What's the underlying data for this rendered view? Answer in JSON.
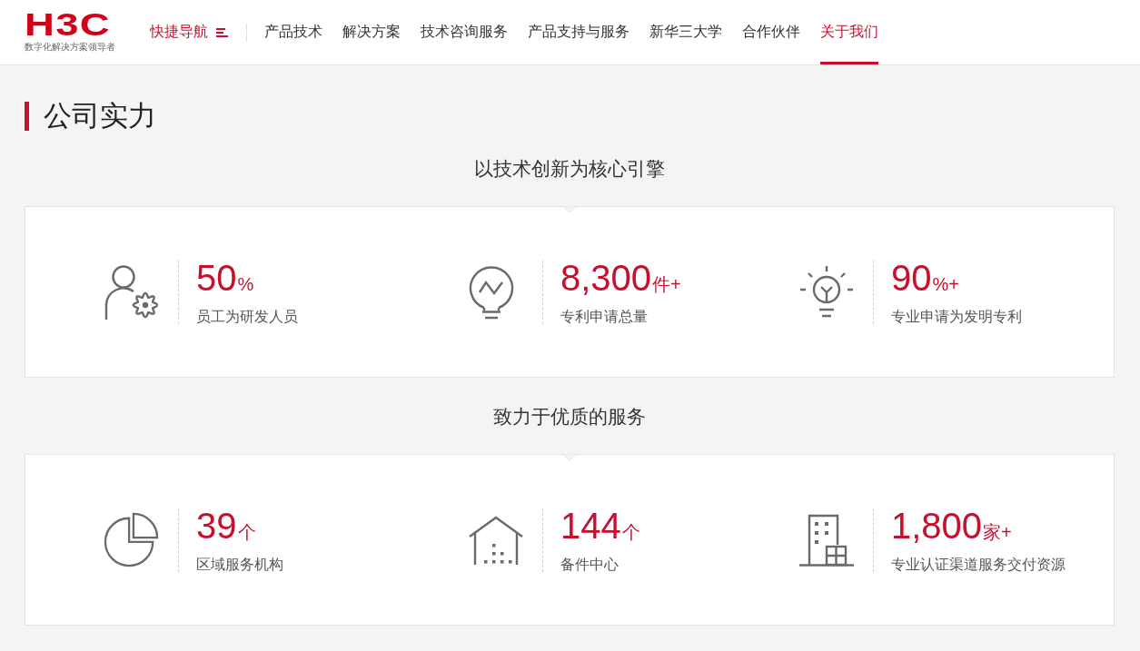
{
  "header": {
    "logo": {
      "wordmark": "H3C",
      "tagline": "数字化解决方案领导者"
    },
    "quick_nav": {
      "label": "快捷导航"
    },
    "nav_items": [
      {
        "label": "产品技术",
        "selected": false
      },
      {
        "label": "解决方案",
        "selected": false
      },
      {
        "label": "技术咨询服务",
        "selected": false
      },
      {
        "label": "产品支持与服务",
        "selected": false
      },
      {
        "label": "新华三大学",
        "selected": false
      },
      {
        "label": "合作伙伴",
        "selected": false
      },
      {
        "label": "关于我们",
        "selected": true
      }
    ]
  },
  "section": {
    "title": "公司实力"
  },
  "groups": [
    {
      "subtitle": "以技术创新为核心引擎",
      "stats": [
        {
          "value": "50",
          "unit": "%",
          "label": "员工为研发人员"
        },
        {
          "value": "8,300",
          "unit": "件+",
          "label": "专利申请总量"
        },
        {
          "value": "90",
          "unit": "%+",
          "label": "专业申请为发明专利"
        }
      ]
    },
    {
      "subtitle": "致力于优质的服务",
      "stats": [
        {
          "value": "39",
          "unit": "个",
          "label": "区域服务机构"
        },
        {
          "value": "144",
          "unit": "个",
          "label": "备件中心"
        },
        {
          "value": "1,800",
          "unit": "家+",
          "label": "专业认证渠道服务交付资源"
        }
      ]
    }
  ]
}
